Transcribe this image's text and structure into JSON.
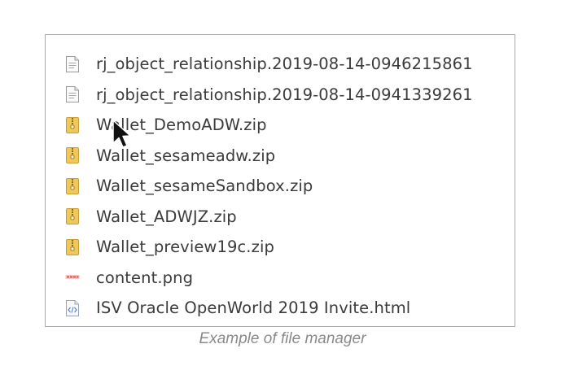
{
  "file_manager": {
    "files": [
      {
        "name": "rj_object_relationship.2019-08-14-0946215861",
        "icon": "text-file-icon"
      },
      {
        "name": "rj_object_relationship.2019-08-14-0941339261",
        "icon": "text-file-icon"
      },
      {
        "name": "Wallet_DemoADW.zip",
        "icon": "zip-archive-icon"
      },
      {
        "name": "Wallet_sesameadw.zip",
        "icon": "zip-archive-icon"
      },
      {
        "name": "Wallet_sesameSandbox.zip",
        "icon": "zip-archive-icon"
      },
      {
        "name": "Wallet_ADWJZ.zip",
        "icon": "zip-archive-icon"
      },
      {
        "name": "Wallet_preview19c.zip",
        "icon": "zip-archive-icon"
      },
      {
        "name": "content.png",
        "icon": "image-file-icon"
      },
      {
        "name": "ISV Oracle OpenWorld 2019 Invite.html",
        "icon": "html-file-icon"
      }
    ]
  },
  "caption": "Example of file manager",
  "colors": {
    "file_text": "#3b3b3b",
    "caption_text": "#8a8a8a",
    "zip_icon": "#f0c75a",
    "panel_border": "#a9a9a9"
  }
}
